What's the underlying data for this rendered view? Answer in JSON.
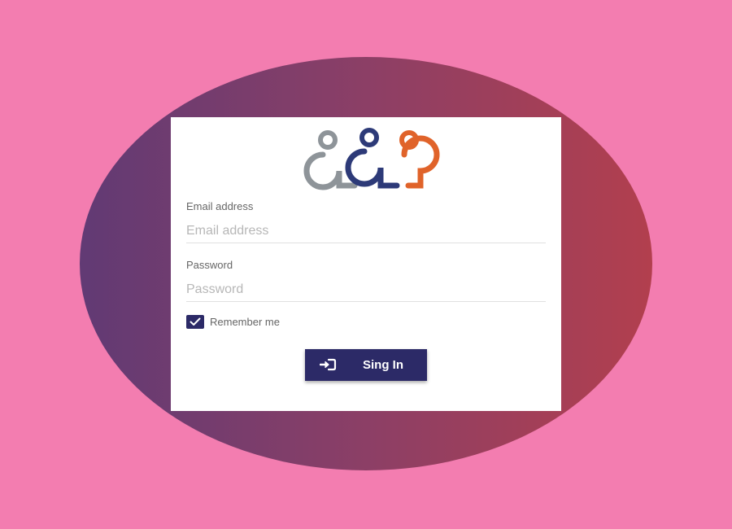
{
  "form": {
    "email_label": "Email address",
    "email_placeholder": "Email address",
    "email_value": "",
    "password_label": "Password",
    "password_placeholder": "Password",
    "password_value": "",
    "remember_label": "Remember me",
    "remember_checked": true,
    "submit_label": "Sing In"
  },
  "colors": {
    "page_background": "#f37db0",
    "gradient_start": "#613a74",
    "gradient_end": "#b23f4e",
    "button": "#2c2a67",
    "logo_gray": "#8e9499",
    "logo_navy": "#2d3a78",
    "logo_orange": "#e0632a"
  },
  "icons": {
    "logo": "people-group-logo-icon",
    "checkbox": "checkmark-icon",
    "submit": "sign-in-icon"
  }
}
